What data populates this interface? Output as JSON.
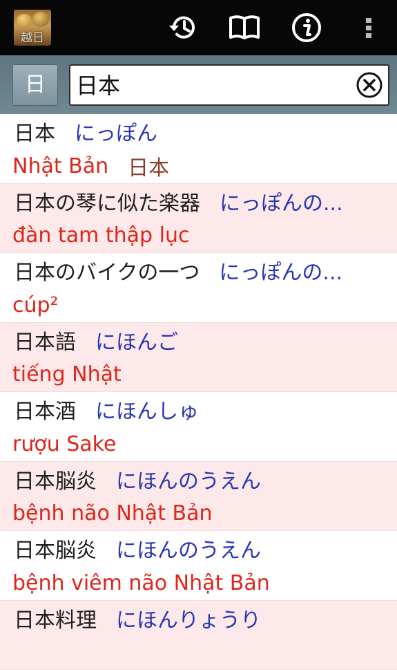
{
  "app": {
    "logo_text": "越日"
  },
  "actionbar": {
    "icons": [
      "history-icon",
      "book-icon",
      "info-icon",
      "overflow-menu-icon"
    ]
  },
  "search": {
    "lang_label": "日",
    "query": "日本"
  },
  "results": [
    {
      "word": "日本",
      "reading": "にっぽん",
      "meaning": "Nhật Bản",
      "kanji": "日本"
    },
    {
      "word": "日本の琴に似た楽器",
      "reading": "にっぽんの...",
      "meaning": "đàn tam thập lục",
      "kanji": ""
    },
    {
      "word": "日本のバイクの一つ",
      "reading": "にっぽんの...",
      "meaning": "cúp²",
      "kanji": ""
    },
    {
      "word": "日本語",
      "reading": "にほんご",
      "meaning": "tiếng Nhật",
      "kanji": ""
    },
    {
      "word": "日本酒",
      "reading": "にほんしゅ",
      "meaning": "rượu Sake",
      "kanji": ""
    },
    {
      "word": "日本脳炎",
      "reading": "にほんのうえん",
      "meaning": "bệnh não Nhật Bản",
      "kanji": ""
    },
    {
      "word": "日本脳炎",
      "reading": "にほんのうえん",
      "meaning": "bệnh viêm não Nhật Bản",
      "kanji": ""
    },
    {
      "word": "日本料理",
      "reading": "にほんりょうり",
      "meaning": "",
      "kanji": ""
    }
  ],
  "colors": {
    "actionbar": "#070707",
    "searchbar": "#6a828c",
    "row_alt": "#fde9ea",
    "reading": "#2836b3",
    "meaning": "#e0251a"
  }
}
